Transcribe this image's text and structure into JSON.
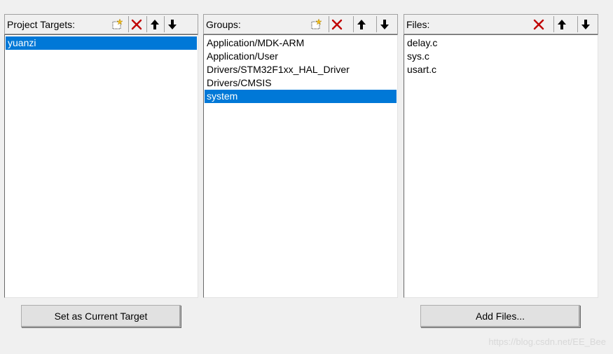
{
  "targets": {
    "header_label": "Project Targets:",
    "items": [
      "yuanzi"
    ],
    "selected_index": 0,
    "button_label": "Set as Current Target"
  },
  "groups": {
    "header_label": "Groups:",
    "items": [
      "Application/MDK-ARM",
      "Application/User",
      "Drivers/STM32F1xx_HAL_Driver",
      "Drivers/CMSIS",
      "system"
    ],
    "selected_index": 4
  },
  "files": {
    "header_label": "Files:",
    "items": [
      "delay.c",
      "sys.c",
      "usart.c"
    ],
    "button_label": "Add Files..."
  },
  "icons": {
    "new": "new-item-icon",
    "delete": "delete-icon",
    "up": "move-up-icon",
    "down": "move-down-icon"
  },
  "colors": {
    "selection": "#0078d7",
    "delete_icon": "#c00000"
  },
  "watermark": "https://blog.csdn.net/EE_Bee"
}
